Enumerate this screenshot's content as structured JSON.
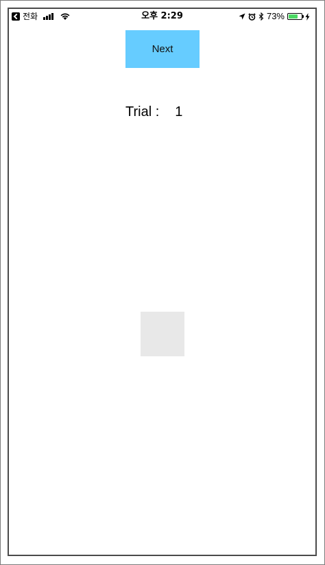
{
  "status_bar": {
    "back_label": "전화",
    "time": "오후 2:29",
    "battery_percent": "73%",
    "battery_level": 0.73,
    "battery_color": "#4cd964",
    "icons": [
      "back-icon",
      "signal-icon",
      "wifi-icon",
      "location-icon",
      "alarm-icon",
      "bluetooth-icon",
      "battery-icon",
      "charging-icon"
    ]
  },
  "main": {
    "next_label": "Next",
    "next_color": "#66ccff",
    "trial_label": "Trial :",
    "trial_value": "1",
    "target_color": "#e8e8e8"
  }
}
